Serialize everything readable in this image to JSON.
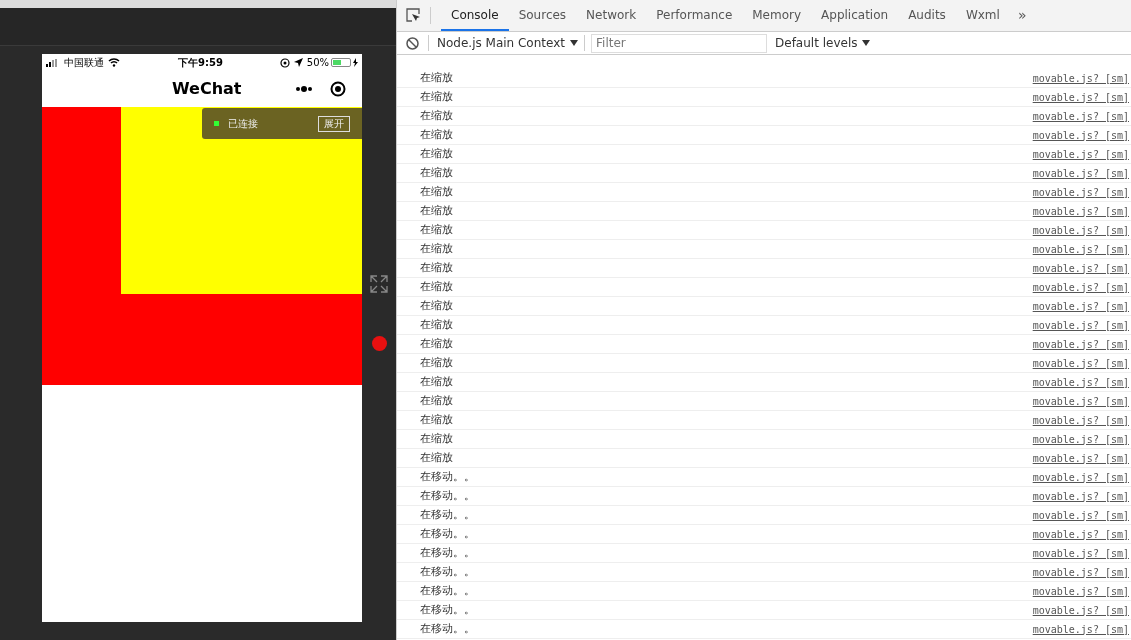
{
  "phone": {
    "status_bar": {
      "carrier": "中国联通",
      "time": "下午9:59",
      "battery": {
        "label": "50%",
        "level": 0.5
      }
    },
    "nav_title": "WeChat",
    "debug_badge": {
      "status": "已连接",
      "connected": true,
      "button": "展开"
    }
  },
  "devtools": {
    "tabs": [
      {
        "label": "Console",
        "selected": true
      },
      {
        "label": "Sources",
        "selected": false
      },
      {
        "label": "Network",
        "selected": false
      },
      {
        "label": "Performance",
        "selected": false
      },
      {
        "label": "Memory",
        "selected": false
      },
      {
        "label": "Application",
        "selected": false
      },
      {
        "label": "Audits",
        "selected": false
      },
      {
        "label": "Wxml",
        "selected": false
      }
    ],
    "more": "»",
    "context": "Node.js Main Context",
    "filter_placeholder": "Filter",
    "levels": "Default levels",
    "console_rows": [
      {
        "message": "在缩放",
        "source": "movable.js? [sm]"
      },
      {
        "message": "在缩放",
        "source": "movable.js? [sm]"
      },
      {
        "message": "在缩放",
        "source": "movable.js? [sm]"
      },
      {
        "message": "在缩放",
        "source": "movable.js? [sm]"
      },
      {
        "message": "在缩放",
        "source": "movable.js? [sm]"
      },
      {
        "message": "在缩放",
        "source": "movable.js? [sm]"
      },
      {
        "message": "在缩放",
        "source": "movable.js? [sm]"
      },
      {
        "message": "在缩放",
        "source": "movable.js? [sm]"
      },
      {
        "message": "在缩放",
        "source": "movable.js? [sm]"
      },
      {
        "message": "在缩放",
        "source": "movable.js? [sm]"
      },
      {
        "message": "在缩放",
        "source": "movable.js? [sm]"
      },
      {
        "message": "在缩放",
        "source": "movable.js? [sm]"
      },
      {
        "message": "在缩放",
        "source": "movable.js? [sm]"
      },
      {
        "message": "在缩放",
        "source": "movable.js? [sm]"
      },
      {
        "message": "在缩放",
        "source": "movable.js? [sm]"
      },
      {
        "message": "在缩放",
        "source": "movable.js? [sm]"
      },
      {
        "message": "在缩放",
        "source": "movable.js? [sm]"
      },
      {
        "message": "在缩放",
        "source": "movable.js? [sm]"
      },
      {
        "message": "在缩放",
        "source": "movable.js? [sm]"
      },
      {
        "message": "在缩放",
        "source": "movable.js? [sm]"
      },
      {
        "message": "在缩放",
        "source": "movable.js? [sm]"
      },
      {
        "message": "在移动。。",
        "source": "movable.js? [sm]"
      },
      {
        "message": "在移动。。",
        "source": "movable.js? [sm]"
      },
      {
        "message": "在移动。。",
        "source": "movable.js? [sm]"
      },
      {
        "message": "在移动。。",
        "source": "movable.js? [sm]"
      },
      {
        "message": "在移动。。",
        "source": "movable.js? [sm]"
      },
      {
        "message": "在移动。。",
        "source": "movable.js? [sm]"
      },
      {
        "message": "在移动。。",
        "source": "movable.js? [sm]"
      },
      {
        "message": "在移动。。",
        "source": "movable.js? [sm]"
      },
      {
        "message": "在移动。。",
        "source": "movable.js? [sm]"
      }
    ]
  }
}
